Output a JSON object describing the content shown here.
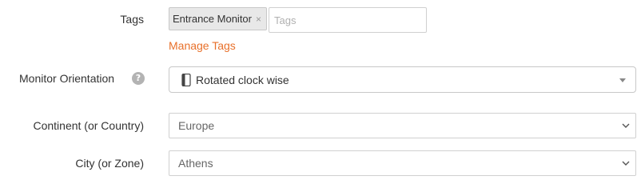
{
  "tags": {
    "label": "Tags",
    "chips": [
      {
        "text": "Entrance Monitor",
        "remove": "×"
      }
    ],
    "placeholder": "Tags",
    "manage_link": "Manage Tags"
  },
  "orientation": {
    "label": "Monitor Orientation",
    "help_icon": "?",
    "value": "Rotated clock wise",
    "icon": "device-portrait-icon"
  },
  "continent": {
    "label": "Continent (or Country)",
    "value": "Europe"
  },
  "city": {
    "label": "City (or Zone)",
    "value": "Athens"
  },
  "colors": {
    "link": "#e8702a",
    "help_icon": "#b3b3b3",
    "chip_bg": "#e8e8e8"
  }
}
